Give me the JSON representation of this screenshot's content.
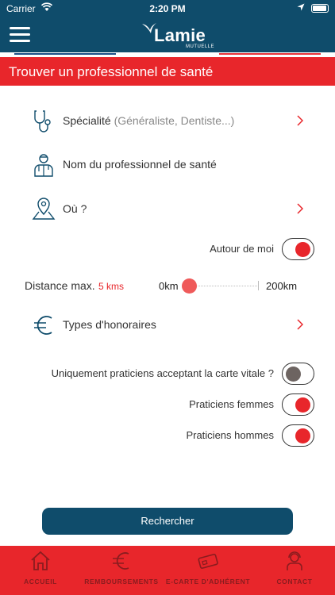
{
  "statusbar": {
    "carrier": "Carrier",
    "time": "2:20 PM"
  },
  "header": {
    "brand": "Lamie",
    "brand_sub": "MUTUELLE"
  },
  "title": "Trouver un professionnel de santé",
  "fields": {
    "specialite": {
      "label": "Spécialité",
      "hint": "(Généraliste, Dentiste...)"
    },
    "nom": {
      "label": "Nom du professionnel de santé"
    },
    "ou": {
      "label": "Où ?"
    },
    "honoraires": {
      "label": "Types d'honoraires"
    }
  },
  "toggles": {
    "autour": {
      "label": "Autour de moi",
      "on": true
    },
    "carte_vitale": {
      "label": "Uniquement praticiens acceptant la carte vitale ?",
      "on": false
    },
    "femmes": {
      "label": "Praticiens femmes",
      "on": true
    },
    "hommes": {
      "label": "Praticiens hommes",
      "on": true
    }
  },
  "distance": {
    "label": "Distance max.",
    "value": "5 kms",
    "min": "0km",
    "max": "200km",
    "current_km": 5
  },
  "search_button": "Rechercher",
  "tabs": [
    {
      "label": "ACCUEIL",
      "icon": "home-icon"
    },
    {
      "label": "REMBOURSEMENTS",
      "icon": "euro-icon"
    },
    {
      "label": "E-CARTE D'ADHÉRENT",
      "icon": "card-icon"
    },
    {
      "label": "CONTACT",
      "icon": "support-agent-icon"
    }
  ],
  "colors": {
    "navy": "#0f4c6b",
    "red": "#e8262b",
    "toggle_off": "#6d6461"
  }
}
